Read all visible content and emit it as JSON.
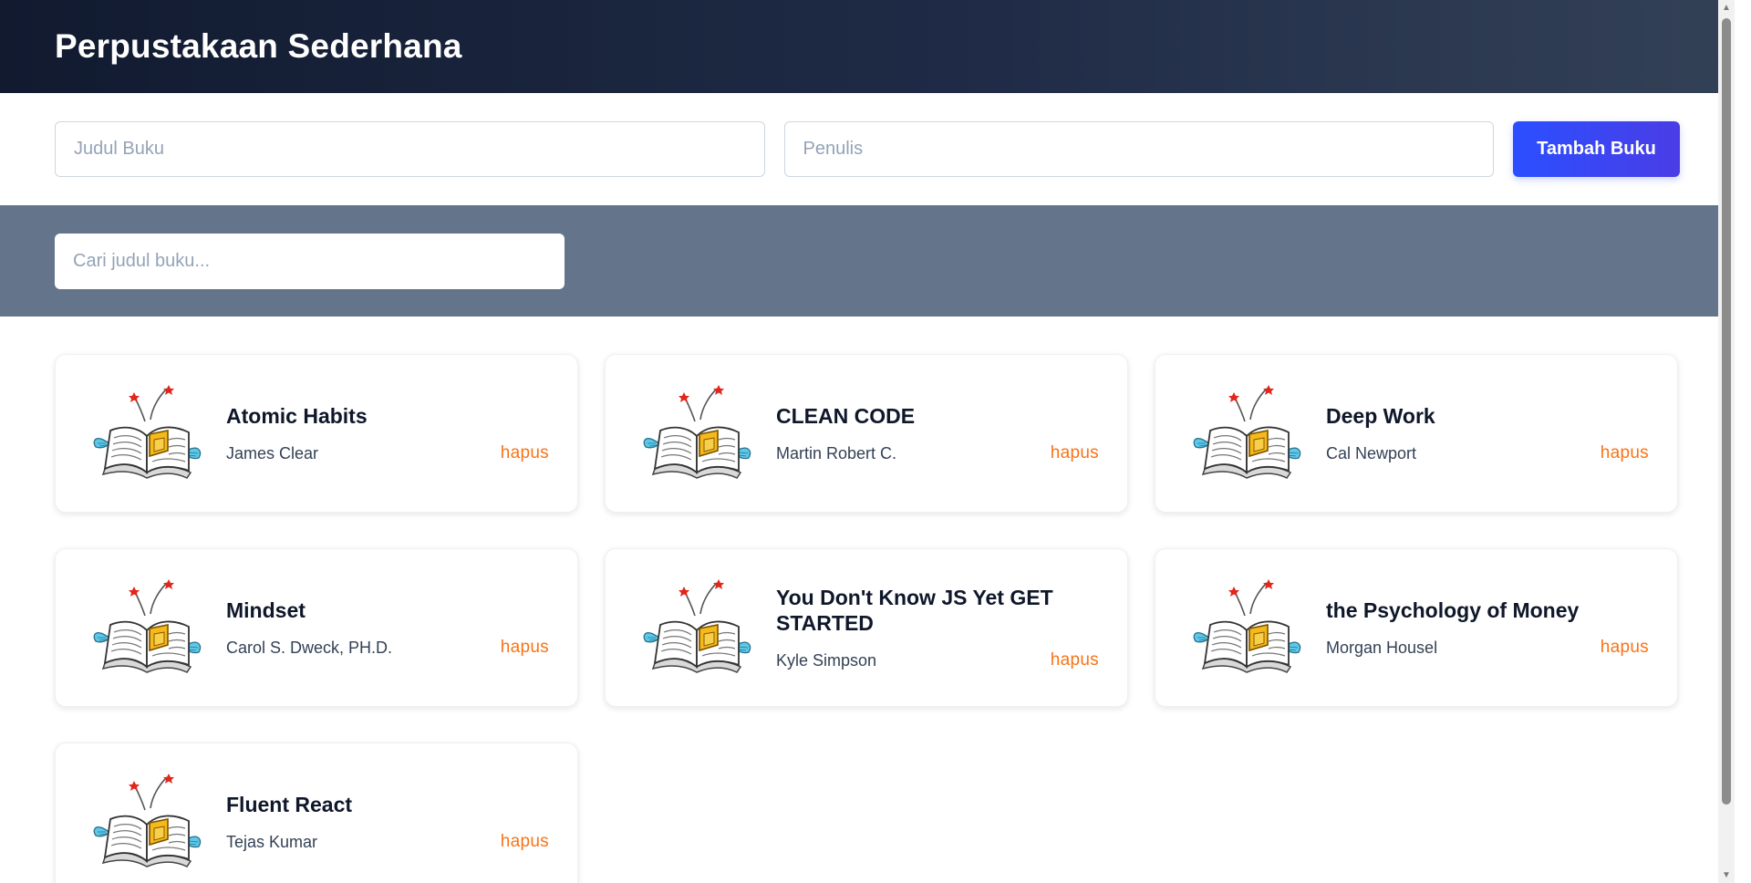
{
  "app": {
    "title": "Perpustakaan Sederhana"
  },
  "form": {
    "title_placeholder": "Judul Buku",
    "title_value": "",
    "author_placeholder": "Penulis",
    "author_value": "",
    "add_label": "Tambah Buku"
  },
  "search": {
    "placeholder": "Cari judul buku...",
    "value": ""
  },
  "books": [
    {
      "title": "Atomic Habits",
      "author": "James Clear",
      "delete_label": "hapus"
    },
    {
      "title": "CLEAN CODE",
      "author": "Martin Robert C.",
      "delete_label": "hapus"
    },
    {
      "title": "Deep Work",
      "author": "Cal Newport",
      "delete_label": "hapus"
    },
    {
      "title": "Mindset",
      "author": "Carol S. Dweck, PH.D.",
      "delete_label": "hapus"
    },
    {
      "title": "You Don't Know JS Yet GET STARTED",
      "author": "Kyle Simpson",
      "delete_label": "hapus"
    },
    {
      "title": "the Psychology of Money",
      "author": "Morgan Housel",
      "delete_label": "hapus"
    },
    {
      "title": "Fluent React",
      "author": "Tejas Kumar",
      "delete_label": "hapus"
    }
  ],
  "icons": {
    "book_thumbnail": "flying-book-icon"
  },
  "colors": {
    "header_start": "#111a2f",
    "header_end": "#334157",
    "search_band": "#64748b",
    "add_button_start": "#2b4fff",
    "add_button_end": "#4a3de6",
    "delete_text": "#f97316"
  }
}
